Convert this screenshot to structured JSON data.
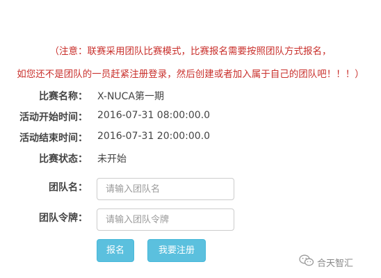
{
  "notice": {
    "line1": "（注意：联赛采用团队比赛模式，比赛报名需要按照团队方式报名，",
    "line2": "如您还不是团队的一员赶紧注册登录，然后创建或者加入属于自己的团队吧！！！）"
  },
  "info": {
    "name_label": "比赛名称：",
    "name_value": "X-NUCA第一期",
    "start_label": "活动开始时间：",
    "start_value": "2016-07-31 08:00:00.0",
    "end_label": "活动结束时间：",
    "end_value": "2016-07-31 20:00:00.0",
    "status_label": "比赛状态：",
    "status_value": "未开始"
  },
  "form": {
    "team_name_label": "团队名：",
    "team_name_placeholder": "请输入团队名",
    "team_token_label": "团队令牌：",
    "team_token_placeholder": "请输入团队令牌",
    "signup_button": "报名",
    "register_button": "我要注册"
  },
  "watermark": {
    "text": "合天智汇",
    "icon": "wechat-icon"
  },
  "colors": {
    "notice": "#c9302c",
    "button": "#5bc0de",
    "button_border": "#46b8da"
  }
}
